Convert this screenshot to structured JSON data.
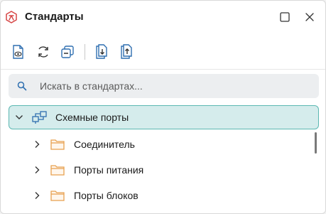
{
  "header": {
    "title": "Стандарты",
    "app_icon": "standards-logo-icon",
    "maximize_icon": "maximize-icon",
    "close_icon": "close-icon"
  },
  "toolbar": {
    "buttons": [
      {
        "icon": "view-document-icon"
      },
      {
        "icon": "refresh-icon"
      },
      {
        "icon": "collapse-all-icon"
      },
      {
        "icon": "import-icon"
      },
      {
        "icon": "export-icon"
      }
    ]
  },
  "search": {
    "placeholder": "Искать в стандартах...",
    "value": ""
  },
  "tree": {
    "root": {
      "label": "Схемные порты",
      "icon": "network-ports-icon",
      "expanded": true,
      "selected": true
    },
    "children": [
      {
        "label": "Соединитель",
        "icon": "folder-icon"
      },
      {
        "label": "Порты питания",
        "icon": "folder-icon"
      },
      {
        "label": "Порты блоков",
        "icon": "folder-icon"
      }
    ]
  },
  "colors": {
    "accent": "#5cb8b2",
    "selection_bg": "#d5ecec",
    "icon_blue": "#2f6fb0",
    "folder_orange": "#e8a14f",
    "logo_red": "#d64545"
  }
}
